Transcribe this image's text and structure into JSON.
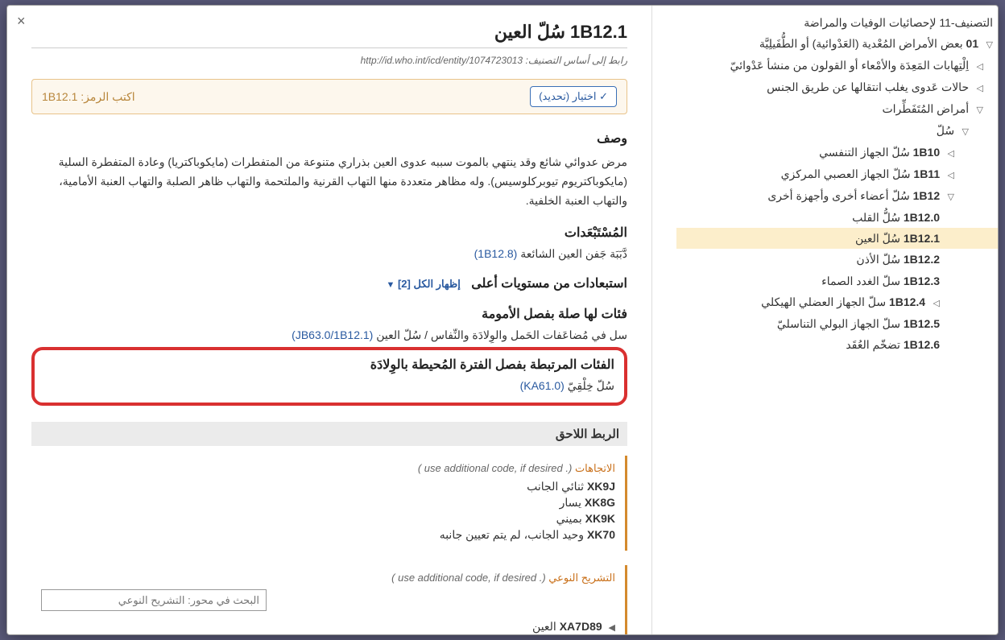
{
  "close_label": "×",
  "title_code": "1B12.1",
  "title_text": "سُلّ العين",
  "foundation_label": "رابط إلى أساس التصنيف:",
  "foundation_url": "http://id.who.int/icd/entity/1074723013",
  "select_button": "✓ اختيار (تحديد)",
  "code_label": "اكتب الرمز:",
  "code_value": "1B12.1",
  "sections": {
    "desc_h": "وصف",
    "desc_text": "مرض عدوائي شائع وقد ينتهي بالموت سببه عدوى العين بذراري متنوعة من المتفطرات (مايكوباكتريا) وعادة المتفطرة السلية (مايكوباكتريوم تيوبركلوسيس). وله مظاهر متعددة منها التهاب القرنية والملتحمة والتهاب ظاهر الصلبة والتهاب العنبة الأمامية، والتهاب العنبة الخلفية.",
    "excl_h": "المُسْتَبْعَدات",
    "excl_text": "دَّبَبَة جَفن العين الشائعة",
    "excl_code": "(1B12.8)",
    "excl_upper_h": "استبعادات من مستويات أعلى",
    "show_all": "إظهار الكل [2]",
    "maternal_h": "فئات لها صلة بفصل الأمومة",
    "maternal_text": "سل في مُضاعَفات الحَمل والوِلادَة والنِّفاس / سُلّ العين",
    "maternal_code": "(JB63.0/1B12.1)",
    "perinatal_h": "الفئات المرتبطة بفصل الفترة المُحيطة بالوِلادَة",
    "perinatal_text": "سُلّ خِلْقِيّ",
    "perinatal_code": "(KA61.0)",
    "postcoord_h": "الربط اللاحق"
  },
  "post_groups": [
    {
      "name": "الاتجاهات",
      "note": "( use additional code, if desired .)",
      "items": [
        {
          "code": "XK9J",
          "label": "ثنائي الجانب"
        },
        {
          "code": "XK8G",
          "label": "يسار"
        },
        {
          "code": "XK9K",
          "label": "بميني"
        },
        {
          "code": "XK70",
          "label": "وحيد الجانب، لم يتم تعيين جانبه"
        }
      ]
    },
    {
      "name": "التشريح النوعي",
      "note": "( use additional code, if desired .)",
      "search_placeholder": "البحث في محور: التشريح النوعي",
      "items": [
        {
          "code": "XA7D89",
          "label": "العين",
          "expandable": true
        }
      ]
    }
  ],
  "tree": [
    {
      "indent": 0,
      "text": "التصنيف-11 لإحصائيات الوفيات والمراضة"
    },
    {
      "indent": 0,
      "toggle": "▽",
      "code": "01",
      "text": "بعض الأمراض المُعْدية (العَدْوائية) أو الطُّفَيلِيَّة"
    },
    {
      "indent": 1,
      "toggle": "◁",
      "text": "اِلْتِهابات المَعِدَة والأمْعاء أو القولون من منشأ عَدْوائيّ"
    },
    {
      "indent": 1,
      "toggle": "◁",
      "text": "حالات عَدوى يغلب انتقالها عن طريق الجنس"
    },
    {
      "indent": 1,
      "toggle": "▽",
      "text": "أمراض المُتَفَطِّرات"
    },
    {
      "indent": 2,
      "toggle": "▽",
      "text": "سُلّ"
    },
    {
      "indent": 3,
      "toggle": "◁",
      "code": "1B10",
      "text": "سُلّ الجهاز التنفسي"
    },
    {
      "indent": 3,
      "toggle": "◁",
      "code": "1B11",
      "text": "سُلّ الجهاز العصبي المركزي"
    },
    {
      "indent": 3,
      "toggle": "▽",
      "code": "1B12",
      "text": "سُلّ أعضاء أخرى وأجهزة أخرى"
    },
    {
      "indent": 4,
      "code": "1B12.0",
      "text": "سُلُّ القلب"
    },
    {
      "indent": 4,
      "sel": true,
      "code": "1B12.1",
      "text": "سُلّ العين"
    },
    {
      "indent": 4,
      "code": "1B12.2",
      "text": "سُلّ الأذن"
    },
    {
      "indent": 4,
      "code": "1B12.3",
      "text": "سلّ الغدد الصماء"
    },
    {
      "indent": 4,
      "toggle": "◁",
      "code": "1B12.4",
      "text": "سلّ الجهاز العضلي الهيكلي"
    },
    {
      "indent": 4,
      "code": "1B12.5",
      "text": "سلّ الجهاز البولي التناسليّ"
    },
    {
      "indent": 4,
      "code": "1B12.6",
      "text": "تضخّم العُقَد"
    }
  ]
}
